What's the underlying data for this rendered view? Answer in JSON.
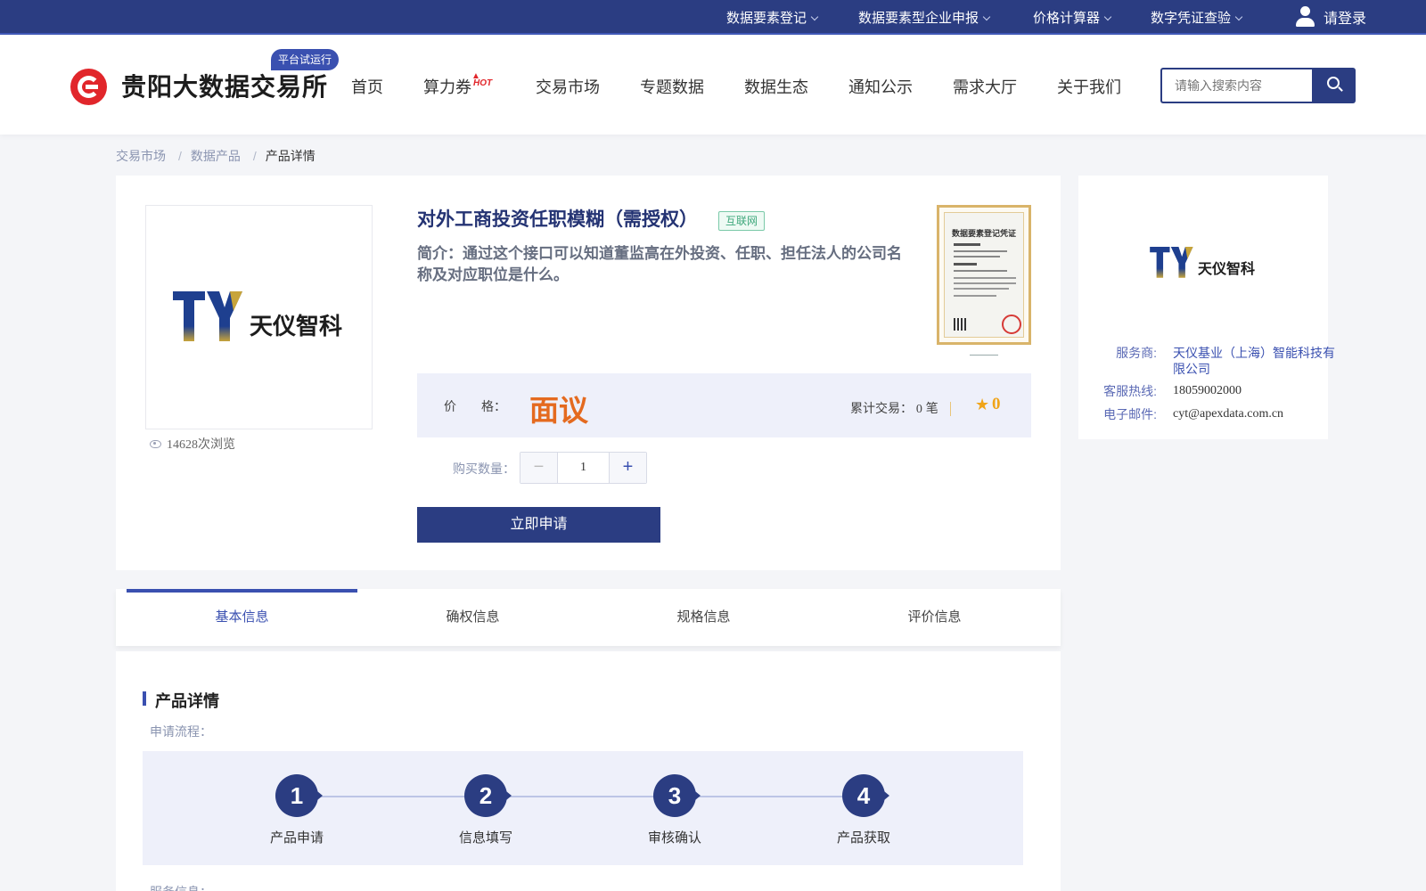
{
  "topbar": {
    "links": [
      "数据要素登记",
      "数据要素型企业申报",
      "价格计算器",
      "数字凭证查验"
    ],
    "login": "请登录"
  },
  "header": {
    "logo_text": "贵阳大数据交易所",
    "beta_badge": "平台试运行",
    "nav": [
      "首页",
      "算力券",
      "交易市场",
      "专题数据",
      "数据生态",
      "通知公示",
      "需求大厅",
      "关于我们"
    ],
    "hot_badge": "HOT",
    "search_placeholder": "请输入搜索内容"
  },
  "breadcrumb": [
    "交易市场",
    "数据产品",
    "产品详情"
  ],
  "product": {
    "title": "对外工商投资任职模糊（需授权）",
    "tag": "互联网",
    "intro": "简介：通过这个接口可以知道董监高在外投资、任职、担任法人的公司名称及对应职位是什么。",
    "brand_name": "天仪智科",
    "views": "14628次浏览",
    "certificate_title": "数据要素登记凭证",
    "price_label": "价　　格：",
    "price_value": "面议",
    "trade_label": "累计交易：",
    "trade_count": "0",
    "trade_unit": "笔",
    "rating": "0",
    "quantity_label": "购买数量：",
    "quantity": "1",
    "apply_button": "立即申请"
  },
  "provider": {
    "brand_name": "天仪智科",
    "rows": [
      {
        "label": "服务商:",
        "value": "天仪基业（上海）智能科技有限公司"
      },
      {
        "label": "客服热线:",
        "value": "18059002000"
      },
      {
        "label": "电子邮件:",
        "value": "cyt@apexdata.com.cn"
      }
    ]
  },
  "tabs": [
    "基本信息",
    "确权信息",
    "规格信息",
    "评价信息"
  ],
  "details": {
    "section_title": "产品详情",
    "flow_label": "申请流程：",
    "steps": [
      {
        "num": "1",
        "label": "产品申请"
      },
      {
        "num": "2",
        "label": "信息填写"
      },
      {
        "num": "3",
        "label": "审核确认"
      },
      {
        "num": "4",
        "label": "产品获取"
      }
    ],
    "service_label": "服务信息："
  },
  "colors": {
    "primary": "#2b3d82",
    "accent": "#3a50b0",
    "price": "#e46a1f",
    "logo_red": "#e1262b",
    "star": "#f0a419"
  }
}
